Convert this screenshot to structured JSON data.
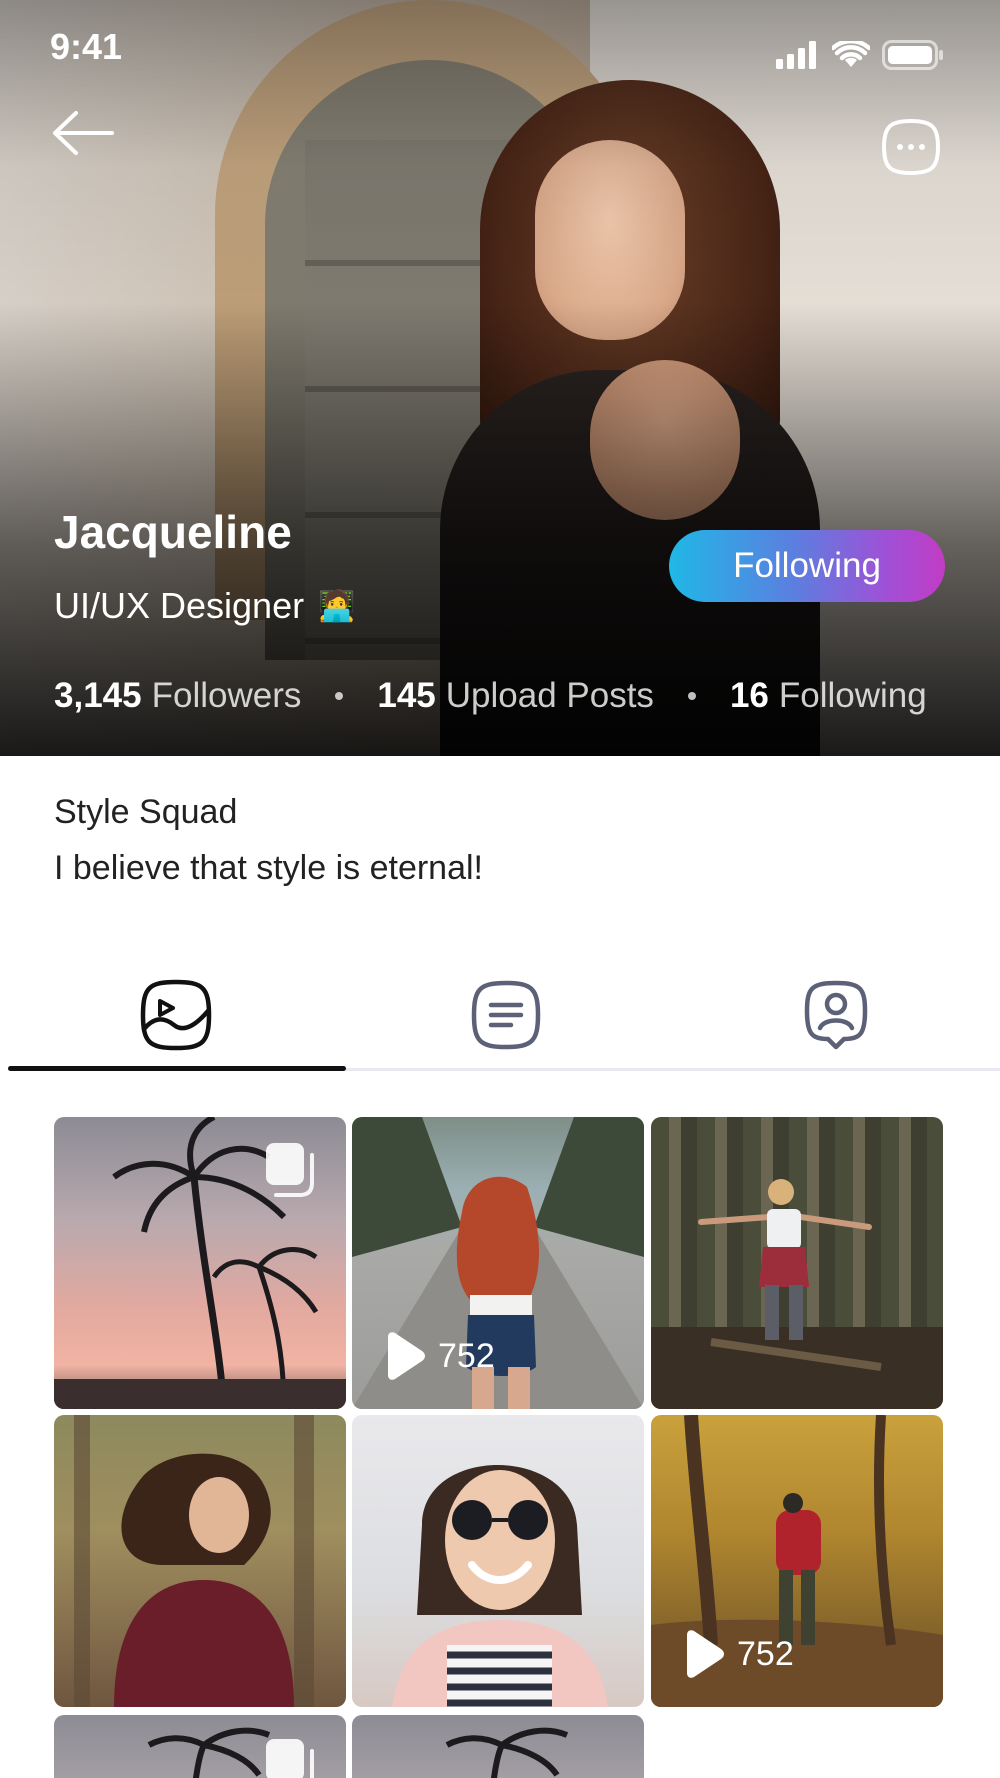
{
  "status_bar": {
    "time": "9:41"
  },
  "profile": {
    "name": "Jacqueline",
    "role": "UI/UX Designer",
    "role_emoji": "🧑‍💻",
    "follow_label": "Following"
  },
  "stats": [
    {
      "value": "3,145",
      "label": "Followers"
    },
    {
      "value": "145",
      "label": "Upload Posts"
    },
    {
      "value": "16",
      "label": "Following"
    }
  ],
  "bio": {
    "title": "Style Squad",
    "text": "I believe that style is eternal!"
  },
  "tabs": [
    {
      "icon": "gallery-icon",
      "active": true
    },
    {
      "icon": "posts-list-icon",
      "active": false
    },
    {
      "icon": "tagged-user-icon",
      "active": false
    }
  ],
  "grid": [
    {
      "kind": "multi-photo",
      "subject": "palm trees at sunset"
    },
    {
      "kind": "video",
      "views": "752",
      "subject": "red-haired woman on road"
    },
    {
      "kind": "photo",
      "subject": "woman walking in forest"
    },
    {
      "kind": "photo",
      "subject": "woman with flowing hair in park"
    },
    {
      "kind": "photo",
      "subject": "smiling woman in sunglasses"
    },
    {
      "kind": "video",
      "views": "752",
      "subject": "hiker in autumn forest"
    },
    {
      "kind": "multi-photo",
      "subject": "palm trees"
    },
    {
      "kind": "photo",
      "subject": "palm trees"
    }
  ],
  "colors": {
    "follow_gradient_start": "#1fb8e6",
    "follow_gradient_end": "#c23cc4",
    "tab_active": "#111111",
    "tab_inactive": "#5d6177"
  }
}
